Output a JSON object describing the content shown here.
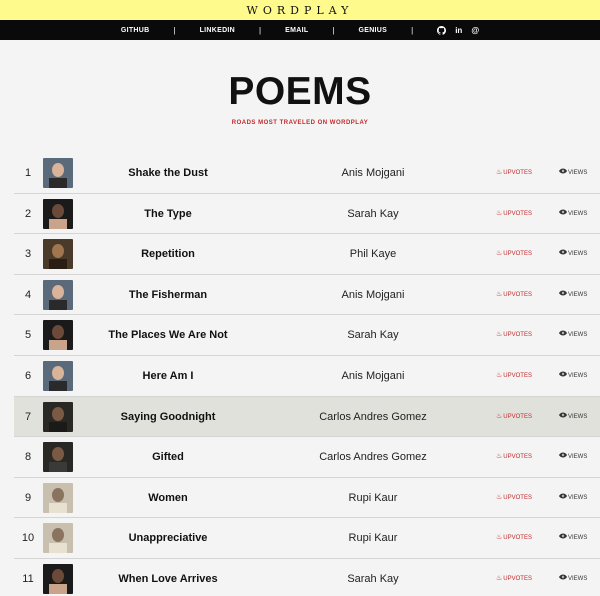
{
  "brand": {
    "title": "WORDPLAY"
  },
  "nav": {
    "links": [
      "GITHUB",
      "LINKEDIN",
      "EMAIL",
      "GENIUS"
    ],
    "separator": "|",
    "icons": [
      "github-icon",
      "linkedin-icon",
      "at-icon"
    ],
    "icon_glyphs": [
      "◉",
      "in",
      "@"
    ]
  },
  "hero": {
    "title": "POEMS",
    "subtitle": "ROADS MOST TRAVELED ON WORDPLAY"
  },
  "colors": {
    "brand_bar": "#fffa8c",
    "nav_bar": "#0a0a0a",
    "accent_red": "#c4292c",
    "row_highlight": "#e1e1dc"
  },
  "labels": {
    "upvotes": "UPVOTES",
    "views": "VIEWS"
  },
  "poems": [
    {
      "rank": "1",
      "title": "Shake the Dust",
      "author": "Anis Mojgani"
    },
    {
      "rank": "2",
      "title": "The Type",
      "author": "Sarah Kay"
    },
    {
      "rank": "3",
      "title": "Repetition",
      "author": "Phil Kaye"
    },
    {
      "rank": "4",
      "title": "The Fisherman",
      "author": "Anis Mojgani"
    },
    {
      "rank": "5",
      "title": "The Places We Are Not",
      "author": "Sarah Kay"
    },
    {
      "rank": "6",
      "title": "Here Am I",
      "author": "Anis Mojgani"
    },
    {
      "rank": "7",
      "title": "Saying Goodnight",
      "author": "Carlos Andres Gomez",
      "highlighted": true
    },
    {
      "rank": "8",
      "title": "Gifted",
      "author": "Carlos Andres Gomez"
    },
    {
      "rank": "9",
      "title": "Women",
      "author": "Rupi Kaur"
    },
    {
      "rank": "10",
      "title": "Unappreciative",
      "author": "Rupi Kaur"
    },
    {
      "rank": "11",
      "title": "When Love Arrives",
      "author": "Sarah Kay"
    }
  ]
}
